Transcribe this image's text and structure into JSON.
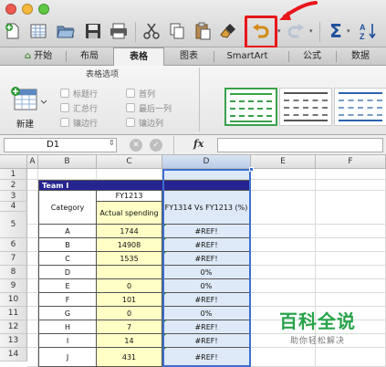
{
  "window": {
    "traffic_lights": [
      "#ee5b4e",
      "#f5b83d",
      "#5fc843"
    ]
  },
  "toolbar": {
    "icons": [
      "new-doc-icon",
      "grid-template-icon",
      "open-folder-icon",
      "save-icon",
      "print-icon",
      "cut-icon",
      "copy-icon",
      "paste-icon",
      "format-brush-icon",
      "undo-icon",
      "redo-icon",
      "autosum-icon",
      "sort-icon"
    ],
    "autosum_symbol": "Σ",
    "highlight_color": "#e8161b"
  },
  "ribbon_tabs": [
    {
      "label": "开始"
    },
    {
      "label": "布局"
    },
    {
      "label": "表格"
    },
    {
      "label": "图表"
    },
    {
      "label": "SmartArt"
    },
    {
      "label": "公式"
    },
    {
      "label": "数据"
    }
  ],
  "ribbon_tab_home_icon": "⌂",
  "ribbon": {
    "group_title": "表格选项",
    "new_label": "新建",
    "options": {
      "header_row": "标题行",
      "total_row": "汇总行",
      "banded_rows": "镶边行",
      "first_column": "首列",
      "last_column": "最后一列",
      "banded_columns": "镶边列"
    }
  },
  "formula_bar": {
    "name_box": "D1",
    "fx": "fx",
    "cancel_symbol": "✕",
    "confirm_symbol": "✓",
    "formula": ""
  },
  "sheet": {
    "columns": [
      "A",
      "B",
      "C",
      "D",
      "E",
      "F"
    ],
    "row_numbers": [
      "1",
      "2",
      "3",
      "4",
      "5",
      "6",
      "7",
      "8",
      "9",
      "10",
      "11",
      "12",
      "13",
      "14"
    ],
    "team_label": "Team I",
    "fy_label": "FY1213",
    "category_header": "Category",
    "actual_spending": "Actual spending",
    "compare_header": "FY1314 Vs FY1213 (%)",
    "rows": [
      {
        "cat": "A",
        "val": "1744",
        "pct": "#REF!"
      },
      {
        "cat": "B",
        "val": "14908",
        "pct": "#REF!"
      },
      {
        "cat": "C",
        "val": "1535",
        "pct": "#REF!"
      },
      {
        "cat": "D",
        "val": "",
        "pct": "0%"
      },
      {
        "cat": "E",
        "val": "0",
        "pct": "0%"
      },
      {
        "cat": "F",
        "val": "101",
        "pct": "#REF!"
      },
      {
        "cat": "G",
        "val": "0",
        "pct": "0%"
      },
      {
        "cat": "H",
        "val": "7",
        "pct": "#REF!"
      },
      {
        "cat": "I",
        "val": "14",
        "pct": "#REF!"
      },
      {
        "cat": "J",
        "val": "431",
        "pct": "#REF!"
      }
    ]
  },
  "watermark": {
    "title": "百科全说",
    "subtitle": "助你轻松解决"
  }
}
